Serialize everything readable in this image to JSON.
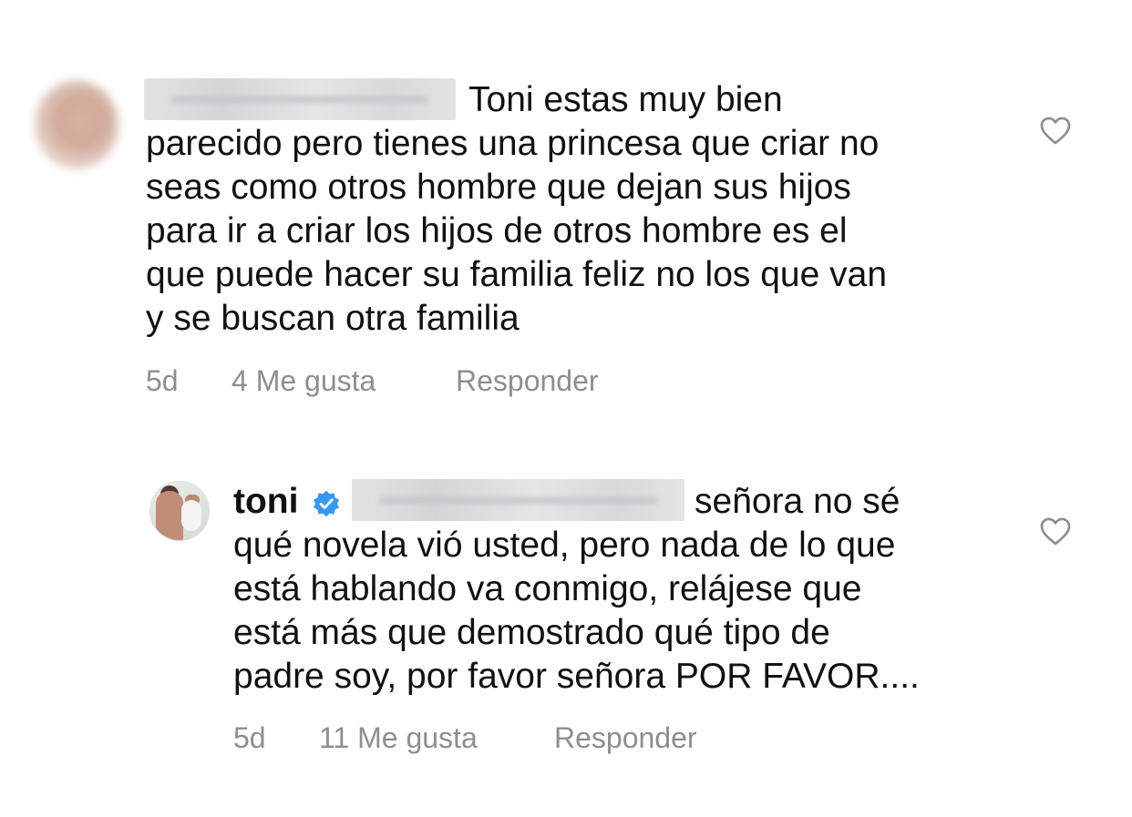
{
  "comments": [
    {
      "username": "",
      "text_lines": [
        "Toni estas muy bien",
        "parecido pero tienes una princesa que criar no",
        "seas como otros hombre que dejan sus hijos",
        "para ir a criar los hijos de otros hombre es el",
        "que puede hacer su familia feliz no los que van",
        "y se buscan otra familia"
      ],
      "time": "5d",
      "likes": "4 Me gusta",
      "reply_label": "Responder",
      "icon": "heart-outline-icon"
    },
    {
      "username": "toni",
      "verified": true,
      "mention": "",
      "text_lines": [
        "señora no sé",
        "qué novela vió usted, pero nada de lo que",
        "está hablando va conmigo, relájese que",
        "está más que demostrado qué tipo de",
        "padre soy, por favor señora POR FAVOR...."
      ],
      "time": "5d",
      "likes": "11 Me gusta",
      "reply_label": "Responder",
      "icon": "heart-outline-icon"
    }
  ],
  "colors": {
    "text": "#111111",
    "meta": "#8e8e8e",
    "verified_badge": "#3897f0",
    "background": "#ffffff"
  }
}
